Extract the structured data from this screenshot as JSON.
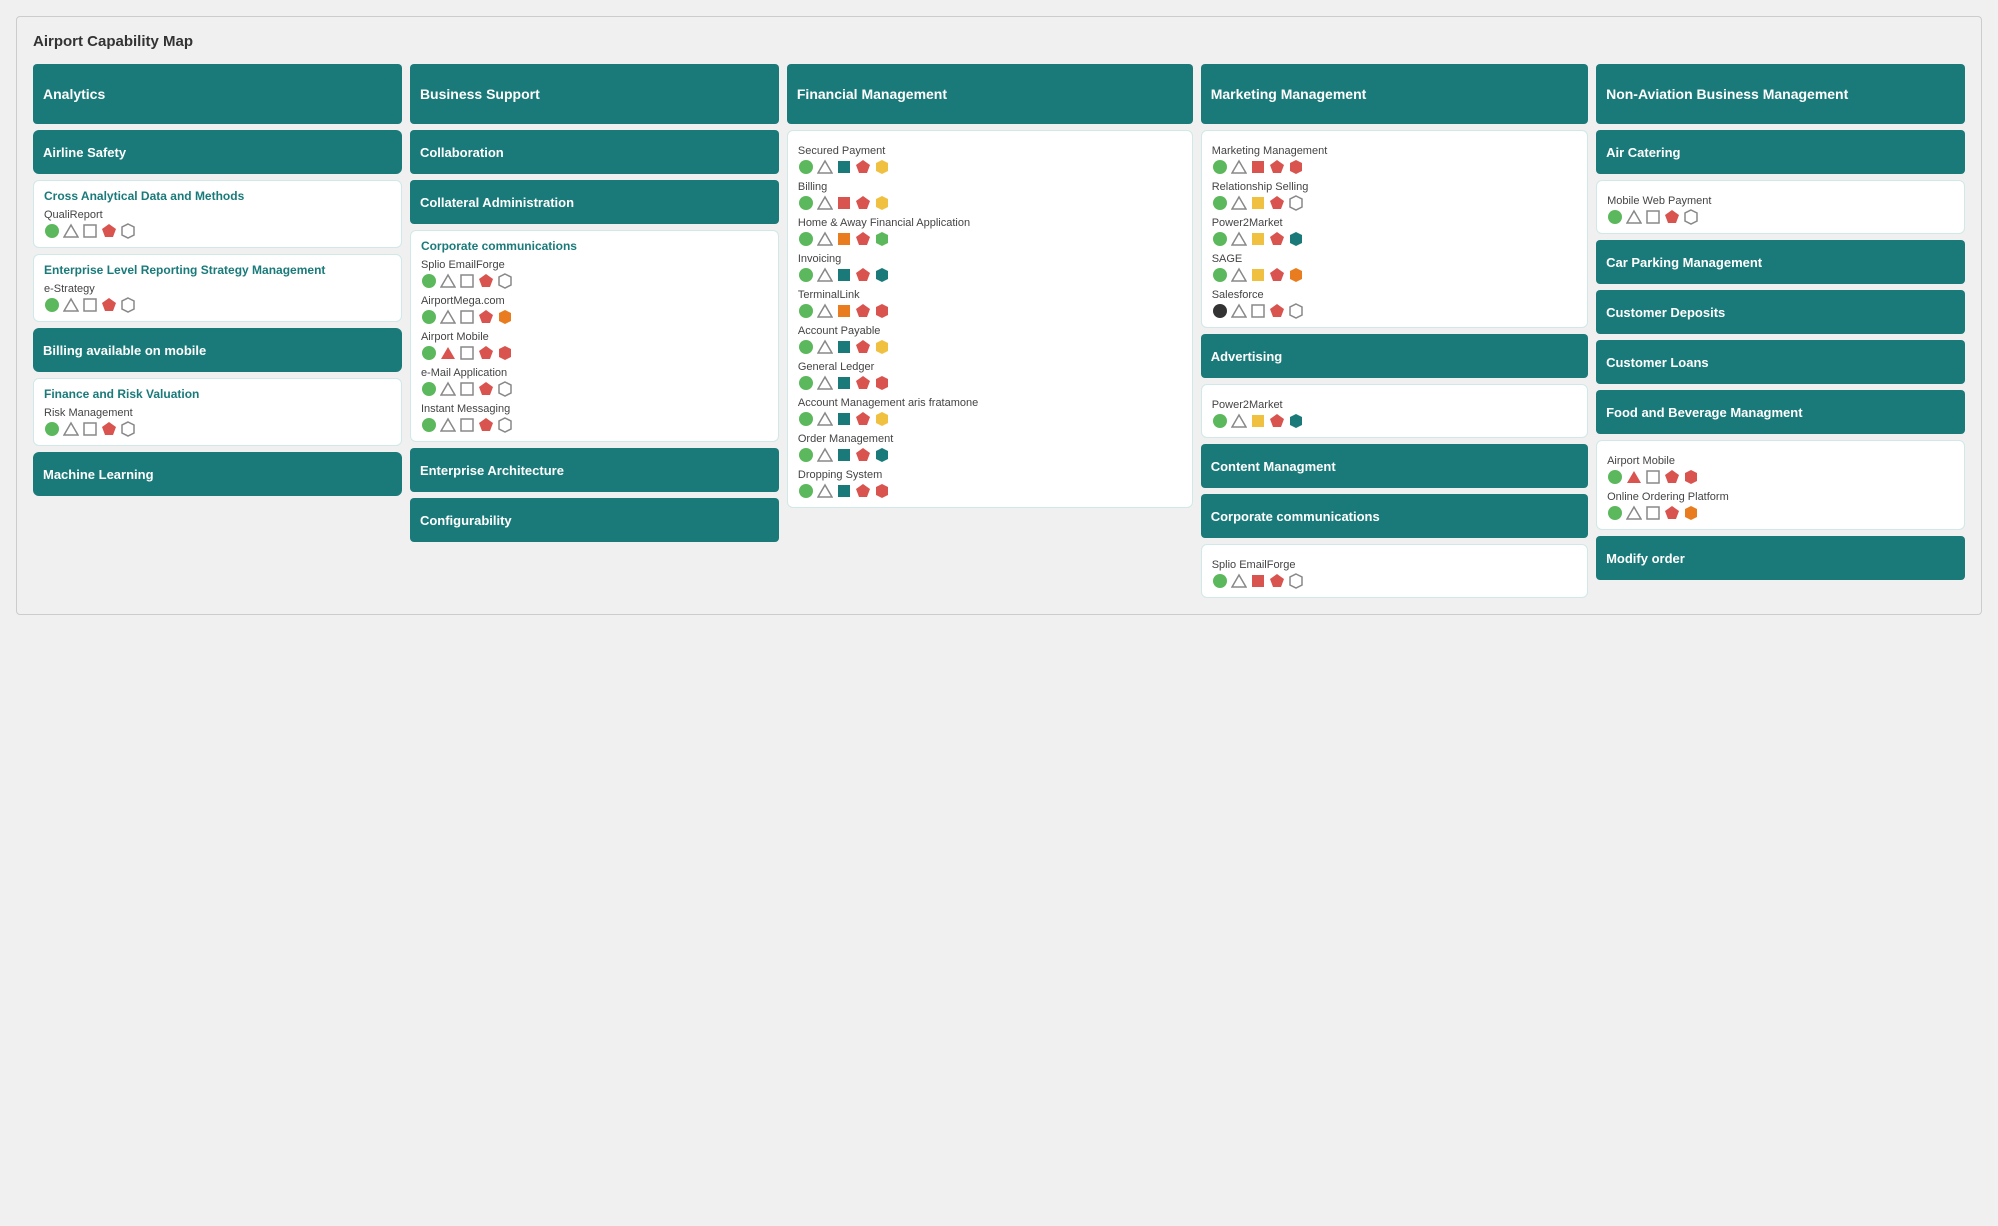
{
  "page": {
    "title": "Airport Capability Map"
  },
  "columns": [
    {
      "id": "analytics",
      "header": "Analytics",
      "sections": [
        {
          "type": "card-dark",
          "label": "Airline Safety"
        },
        {
          "type": "card-white",
          "label": "Cross Analytical Data and Methods",
          "items": [
            {
              "name": "QualiReport",
              "icons": [
                "green-circle",
                "gray-triangle",
                "white-square",
                "red-pentagon",
                "white-hexagon"
              ]
            }
          ]
        },
        {
          "type": "card-white",
          "label": "Enterprise Level Reporting Strategy Management",
          "items": [
            {
              "name": "e-Strategy",
              "icons": [
                "green-circle",
                "gray-triangle",
                "white-square",
                "red-pentagon",
                "white-hexagon"
              ]
            }
          ]
        },
        {
          "type": "card-dark",
          "label": "Billing available on mobile"
        },
        {
          "type": "card-dark",
          "label": "Finance and Risk Valuation",
          "items": [
            {
              "name": "Risk Management",
              "icons": [
                "green-circle",
                "gray-triangle",
                "white-square",
                "red-pentagon",
                "white-hexagon"
              ]
            }
          ]
        },
        {
          "type": "card-dark",
          "label": "Machine Learning"
        }
      ]
    },
    {
      "id": "business-support",
      "header": "Business Support",
      "sections": [
        {
          "type": "section-header",
          "label": "Collaboration"
        },
        {
          "type": "section-header",
          "label": "Collateral Administration"
        },
        {
          "type": "section-card",
          "label": "Corporate communications",
          "items": [
            {
              "name": "Splio EmailForge",
              "icons": [
                "green-circle",
                "gray-triangle",
                "white-square",
                "red-pentagon",
                "white-hexagon"
              ]
            },
            {
              "name": "AirportMega.com",
              "icons": [
                "green-circle",
                "gray-triangle",
                "white-square",
                "red-pentagon",
                "orange-hexagon"
              ]
            },
            {
              "name": "Airport Mobile",
              "icons": [
                "green-circle",
                "red-triangle",
                "white-square",
                "red-pentagon",
                "red-hexagon"
              ]
            },
            {
              "name": "e-Mail Application",
              "icons": [
                "green-circle",
                "gray-triangle",
                "white-square",
                "red-pentagon",
                "white-hexagon"
              ]
            },
            {
              "name": "Instant Messaging",
              "icons": [
                "green-circle",
                "gray-triangle",
                "white-square",
                "red-pentagon",
                "white-hexagon"
              ]
            }
          ]
        },
        {
          "type": "section-header",
          "label": "Enterprise Architecture"
        },
        {
          "type": "section-header",
          "label": "Configurability"
        }
      ]
    },
    {
      "id": "financial-management",
      "header": "Financial Management",
      "items_flat": [
        {
          "name": "Secured Payment",
          "icons": [
            "green-circle",
            "gray-triangle",
            "teal-square",
            "red-pentagon",
            "yellow-hexagon"
          ]
        },
        {
          "name": "Billing",
          "icons": [
            "green-circle",
            "gray-triangle",
            "red-square",
            "red-pentagon",
            "yellow-hexagon"
          ]
        },
        {
          "name": "Home & Away Financial Application",
          "icons": [
            "green-circle",
            "gray-triangle",
            "orange-square",
            "red-pentagon",
            "green-hexagon"
          ]
        },
        {
          "name": "Invoicing",
          "icons": [
            "green-circle",
            "gray-triangle",
            "teal-square",
            "red-pentagon",
            "teal-hexagon"
          ]
        },
        {
          "name": "TerminalLink",
          "icons": [
            "green-circle",
            "gray-triangle",
            "orange-square",
            "red-pentagon",
            "red-hexagon"
          ]
        },
        {
          "name": "Account Payable",
          "icons": [
            "green-circle",
            "gray-triangle",
            "teal-square",
            "red-pentagon",
            "yellow-hexagon"
          ]
        },
        {
          "name": "General Ledger",
          "icons": [
            "green-circle",
            "gray-triangle",
            "teal-square",
            "red-pentagon",
            "red-hexagon"
          ]
        },
        {
          "name": "Account Management aris fratamone",
          "icons": [
            "green-circle",
            "gray-triangle",
            "teal-square",
            "red-pentagon",
            "yellow-hexagon"
          ]
        },
        {
          "name": "Order Management",
          "icons": [
            "green-circle",
            "gray-triangle",
            "teal-square",
            "red-pentagon",
            "teal-hexagon"
          ]
        },
        {
          "name": "Dropping System",
          "icons": [
            "green-circle",
            "gray-triangle",
            "teal-square",
            "red-pentagon",
            "red-hexagon"
          ]
        }
      ]
    },
    {
      "id": "marketing-management",
      "header": "Marketing Management",
      "sections": [
        {
          "type": "section-items",
          "label": "Marketing Management",
          "items": [
            {
              "name": "Marketing Management",
              "icons": [
                "green-circle",
                "gray-triangle",
                "red-square",
                "red-pentagon",
                "red-hexagon"
              ]
            },
            {
              "name": "Relationship Selling",
              "icons": [
                "green-circle",
                "gray-triangle",
                "yellow-square",
                "red-pentagon",
                "white-hexagon"
              ]
            },
            {
              "name": "Power2Market",
              "icons": [
                "green-circle",
                "gray-triangle",
                "yellow-square",
                "red-pentagon",
                "teal-hexagon"
              ]
            },
            {
              "name": "SAGE",
              "icons": [
                "green-circle",
                "gray-triangle",
                "yellow-square",
                "red-pentagon",
                "orange-hexagon"
              ]
            },
            {
              "name": "Salesforce",
              "icons": [
                "dark-circle",
                "gray-triangle",
                "white-square",
                "red-pentagon",
                "white-hexagon"
              ]
            }
          ]
        },
        {
          "type": "section-header",
          "label": "Advertising"
        },
        {
          "type": "section-items-plain",
          "items": [
            {
              "name": "Power2Market",
              "icons": [
                "green-circle",
                "gray-triangle",
                "yellow-square",
                "red-pentagon",
                "teal-hexagon"
              ]
            }
          ]
        },
        {
          "type": "section-header",
          "label": "Content Managment"
        },
        {
          "type": "section-header",
          "label": "Corporate communications"
        },
        {
          "type": "section-items-plain",
          "items": [
            {
              "name": "Splio EmailForge",
              "icons": [
                "green-circle",
                "gray-triangle",
                "red-square",
                "red-pentagon",
                "white-hexagon"
              ]
            }
          ]
        }
      ]
    },
    {
      "id": "non-aviation",
      "header": "Non-Aviation Business Management",
      "sections": [
        {
          "type": "section-header",
          "label": "Air Catering"
        },
        {
          "type": "section-items-plain",
          "items": [
            {
              "name": "Mobile Web Payment",
              "icons": [
                "green-circle",
                "gray-triangle",
                "white-square",
                "red-pentagon",
                "white-hexagon"
              ]
            }
          ]
        },
        {
          "type": "section-header",
          "label": "Car Parking Management"
        },
        {
          "type": "section-header",
          "label": "Customer Deposits"
        },
        {
          "type": "section-header",
          "label": "Customer Loans"
        },
        {
          "type": "section-header",
          "label": "Food and Beverage Managment"
        },
        {
          "type": "section-items-plain",
          "items": [
            {
              "name": "Airport Mobile",
              "icons": [
                "green-circle",
                "red-triangle",
                "white-square",
                "red-pentagon",
                "red-hexagon"
              ]
            },
            {
              "name": "Online Ordering Platform",
              "icons": [
                "green-circle",
                "gray-triangle",
                "white-square",
                "red-pentagon",
                "orange-hexagon"
              ]
            }
          ]
        },
        {
          "type": "section-header",
          "label": "Modify order"
        }
      ]
    }
  ]
}
